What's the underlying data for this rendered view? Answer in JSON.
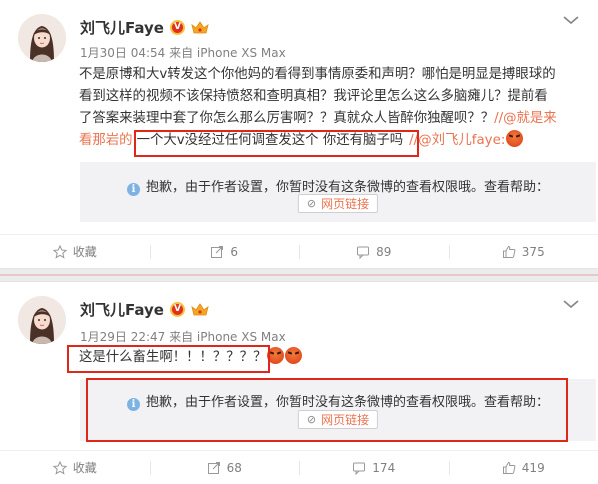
{
  "posts": [
    {
      "author": "刘飞儿Faye",
      "meta": "1月30日 04:54 来自 iPhone XS Max",
      "body_lines": [
        "不是原博和大v转发这个你他妈的看得到事情原委和声明？哪怕是明显是搏眼球的",
        "看到这样的视频不该保持愤怒和查明真相？我评论里怎么这么多脑瘫儿？提前看",
        "了答案来装理中套了你怎么那么厉害啊？？真就众人皆醉你独醒呗？？"
      ],
      "repost_prefix": "//",
      "repost_user1": "@就是来",
      "repost_user1_cont": "看那岩的",
      "repost_text": "一个大v没经过任何调查发这个 你还有脑子吗",
      "repost_sep": "//",
      "repost_user2": "@刘飞儿faye",
      "repost_colon": ":",
      "notice_text": "抱歉，由于作者设置，你暂时没有这条微博的查看权限哦。查看帮助：",
      "notice_link": "网页链接",
      "actions": {
        "favorite": "收藏",
        "repost": "6",
        "comment": "89",
        "like": "375"
      }
    },
    {
      "author": "刘飞儿Faye",
      "meta": "1月29日 22:47 来自 iPhone XS Max",
      "body_text": "这是什么畜生啊！！！？？？？",
      "notice_text": "抱歉，由于作者设置，你暂时没有这条微博的查看权限哦。查看帮助：",
      "notice_link": "网页链接",
      "actions": {
        "favorite": "收藏",
        "repost": "68",
        "comment": "174",
        "like": "419"
      }
    }
  ],
  "icons": [
    "avatar-illustration",
    "vip-v-badge",
    "crown-icon",
    "chevron-down-icon",
    "info-icon",
    "link-clip-icon",
    "star-icon",
    "repost-icon",
    "comment-icon",
    "thumbs-up-icon",
    "angry-emoji"
  ],
  "colors": {
    "link": "#eb7350",
    "annotation_red": "#e0251b",
    "notice_bg": "#f2f2f5"
  }
}
